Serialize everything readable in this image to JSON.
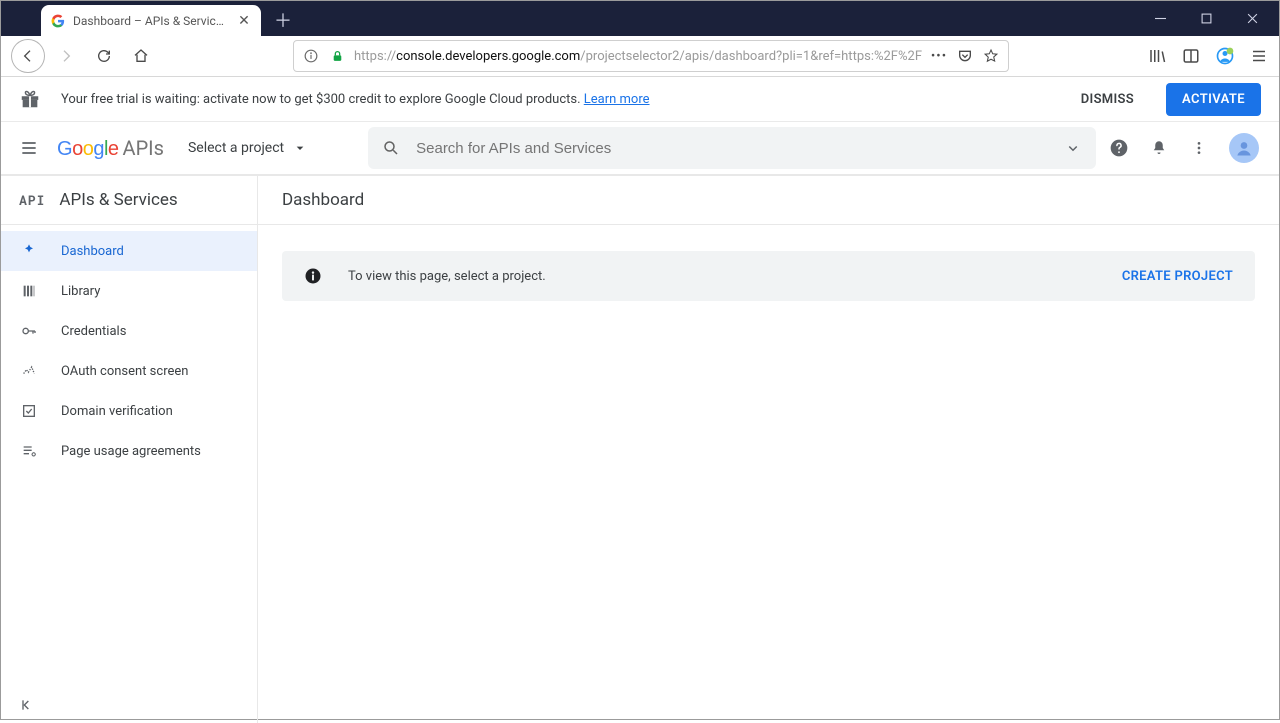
{
  "browser": {
    "tab_title": "Dashboard – APIs & Services – ",
    "url_prefix": "https://",
    "url_host": "console.developers.google.com",
    "url_path": "/projectselector2/apis/dashboard?pli=1&ref=https:%2F%2F"
  },
  "trial": {
    "message": "Your free trial is waiting: activate now to get $300 credit to explore Google Cloud products. ",
    "learn_more": "Learn more",
    "dismiss": "DISMISS",
    "activate": "ACTIVATE"
  },
  "header": {
    "brand_suffix": "APIs",
    "project_selector": "Select a project",
    "search_placeholder": "Search for APIs and Services"
  },
  "sidebar": {
    "section": "APIs & Services",
    "items": [
      {
        "label": "Dashboard"
      },
      {
        "label": "Library"
      },
      {
        "label": "Credentials"
      },
      {
        "label": "OAuth consent screen"
      },
      {
        "label": "Domain verification"
      },
      {
        "label": "Page usage agreements"
      }
    ]
  },
  "page": {
    "title": "Dashboard",
    "info_message": "To view this page, select a project.",
    "create_project": "CREATE PROJECT"
  }
}
